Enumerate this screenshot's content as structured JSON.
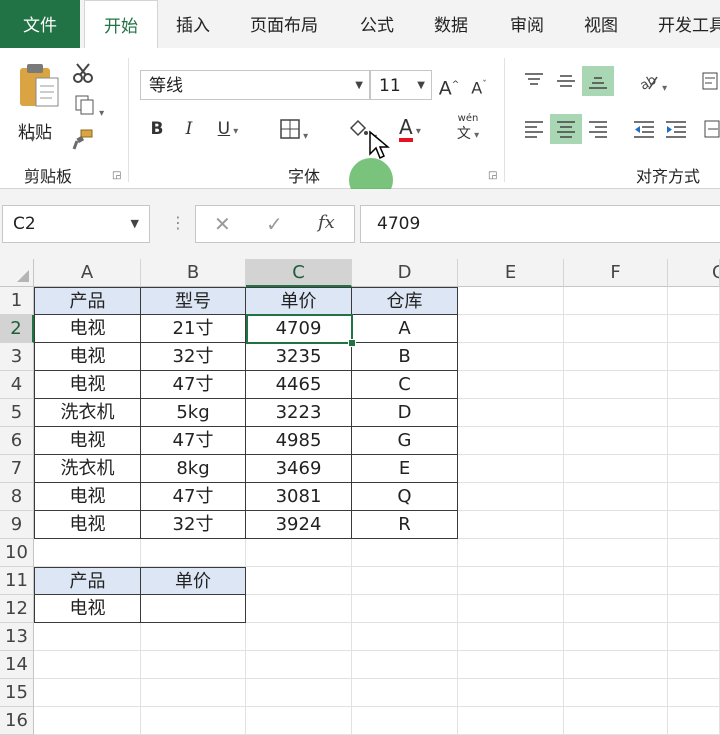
{
  "ribbon_tabs": [
    "文件",
    "开始",
    "插入",
    "页面布局",
    "公式",
    "数据",
    "审阅",
    "视图",
    "开发工具"
  ],
  "clipboard": {
    "paste_label": "粘贴",
    "group_label": "剪贴板"
  },
  "font": {
    "family": "等线",
    "size": "11",
    "bold": "B",
    "italic": "I",
    "underline": "U",
    "wen": "wén",
    "wen_char": "文",
    "font_color_label": "A",
    "group_label": "字体"
  },
  "alignment": {
    "group_label": "对齐方式"
  },
  "formula_bar": {
    "name_box": "C2",
    "cancel": "✕",
    "enter": "✓",
    "fx": "fx",
    "value": "4709"
  },
  "columns": [
    "A",
    "B",
    "C",
    "D",
    "E",
    "F",
    "G"
  ],
  "rows": [
    "1",
    "2",
    "3",
    "4",
    "5",
    "6",
    "7",
    "8",
    "9",
    "10",
    "11",
    "12",
    "13",
    "14",
    "15",
    "16"
  ],
  "table1": {
    "headers": [
      "产品",
      "型号",
      "单价",
      "仓库"
    ],
    "rows": [
      [
        "电视",
        "21寸",
        "4709",
        "A"
      ],
      [
        "电视",
        "32寸",
        "3235",
        "B"
      ],
      [
        "电视",
        "47寸",
        "4465",
        "C"
      ],
      [
        "洗衣机",
        "5kg",
        "3223",
        "D"
      ],
      [
        "电视",
        "47寸",
        "4985",
        "G"
      ],
      [
        "洗衣机",
        "8kg",
        "3469",
        "E"
      ],
      [
        "电视",
        "47寸",
        "3081",
        "Q"
      ],
      [
        "电视",
        "32寸",
        "3924",
        "R"
      ]
    ]
  },
  "table2": {
    "headers": [
      "产品",
      "单价"
    ],
    "rows": [
      [
        "电视",
        ""
      ]
    ]
  },
  "colors": {
    "accent": "#217346",
    "header_fill": "#dce6f4",
    "highlight": "#a9d6b3",
    "font_color_bar": "#e81123"
  }
}
